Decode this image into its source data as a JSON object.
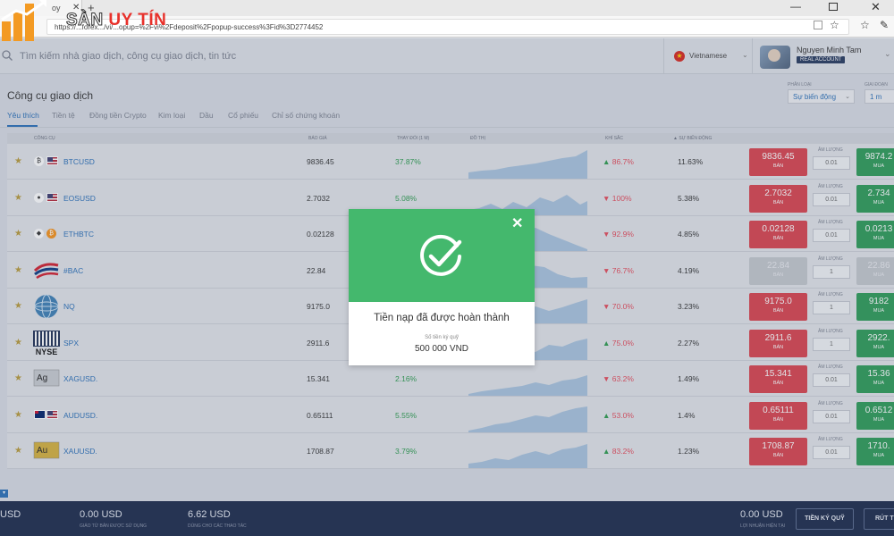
{
  "browser": {
    "tab_title": "oy",
    "url": "https://...forex.../vi/...opup=%2Fvi%2Fdeposit%2Fpopup-success%3Fid%3D2774452"
  },
  "watermark": {
    "part_a": "SÀN ",
    "part_b": "UY TÍN"
  },
  "header": {
    "search_placeholder": "Tìm kiếm nhà giao dịch, công cụ giao dịch, tin tức",
    "language": "Vietnamese",
    "user_name": "Nguyen Minh Tam",
    "account_badge": "REAL ACCOUNT"
  },
  "page": {
    "title": "Công cụ giao dịch",
    "tabs": [
      "Yêu thích",
      "Tiền tệ",
      "Đồng tiền Crypto",
      "Kim loại",
      "Dầu",
      "Cổ phiếu",
      "Chỉ số chứng khoán"
    ],
    "active_tab": "Yêu thích",
    "filter_category_label": "PHÂN LOẠI",
    "filter_category_value": "Sự biến động",
    "filter_period_label": "GIAI ĐOẠN",
    "filter_period_value": "1 m"
  },
  "table": {
    "columns": {
      "instrument": "CÔNG CỤ",
      "price": "BÁO GIÁ",
      "change": "THAY ĐỔI (1 M)",
      "chart": "ĐỒ THỊ",
      "sentiment": "KHÍ SẮC",
      "volatility": "▲ SỰ BIẾN ĐỘNG"
    },
    "qty_label": "ÂM LƯỢNG",
    "sell_label": "BÁN",
    "buy_label": "MUA",
    "rows": [
      {
        "symbol": "BTCUSD",
        "price": "9836.45",
        "change": "37.87%",
        "sentiment_dir": "up",
        "sentiment": "86.7%",
        "volatility": "11.63%",
        "sell": "9836.45",
        "qty": "0.01",
        "buy": "9874.2",
        "icon": "btc",
        "disabled": false
      },
      {
        "symbol": "EOSUSD",
        "price": "2.7032",
        "change": "5.08%",
        "sentiment_dir": "down",
        "sentiment": "100%",
        "volatility": "5.38%",
        "sell": "2.7032",
        "qty": "0.01",
        "buy": "2.734",
        "icon": "eos",
        "disabled": false
      },
      {
        "symbol": "ETHBTC",
        "price": "0.02128",
        "change": "",
        "sentiment_dir": "down",
        "sentiment": "92.9%",
        "volatility": "4.85%",
        "sell": "0.02128",
        "qty": "0.01",
        "buy": "0.0213",
        "icon": "eth",
        "disabled": false
      },
      {
        "symbol": "#BAC",
        "price": "22.84",
        "change": "",
        "sentiment_dir": "down",
        "sentiment": "76.7%",
        "volatility": "4.19%",
        "sell": "22.84",
        "qty": "1",
        "buy": "22.86",
        "icon": "bac",
        "disabled": true
      },
      {
        "symbol": "NQ",
        "price": "9175.0",
        "change": "",
        "sentiment_dir": "down",
        "sentiment": "70.0%",
        "volatility": "3.23%",
        "sell": "9175.0",
        "qty": "1",
        "buy": "9182",
        "icon": "nq",
        "disabled": false
      },
      {
        "symbol": "SPX",
        "price": "2911.6",
        "change": "",
        "sentiment_dir": "up",
        "sentiment": "75.0%",
        "volatility": "2.27%",
        "sell": "2911.6",
        "qty": "1",
        "buy": "2922.",
        "icon": "nyse",
        "disabled": false
      },
      {
        "symbol": "XAGUSD.",
        "price": "15.341",
        "change": "2.16%",
        "sentiment_dir": "down",
        "sentiment": "63.2%",
        "volatility": "1.49%",
        "sell": "15.341",
        "qty": "0.01",
        "buy": "15.36",
        "icon": "ag",
        "disabled": false
      },
      {
        "symbol": "AUDUSD.",
        "price": "0.65111",
        "change": "5.55%",
        "sentiment_dir": "up",
        "sentiment": "53.0%",
        "volatility": "1.4%",
        "sell": "0.65111",
        "qty": "0.01",
        "buy": "0.6512",
        "icon": "aud",
        "disabled": false
      },
      {
        "symbol": "XAUUSD.",
        "price": "1708.87",
        "change": "3.79%",
        "sentiment_dir": "up",
        "sentiment": "83.2%",
        "volatility": "1.23%",
        "sell": "1708.87",
        "qty": "0.01",
        "buy": "1710.",
        "icon": "au",
        "disabled": false
      }
    ]
  },
  "icon_labels": {
    "ag": "Ag",
    "au": "Au",
    "nyse": "NYSE"
  },
  "footer": {
    "tag": "▾",
    "usd_partial": "USD",
    "margin_value": "0.00 USD",
    "margin_label": "GIÁO TỪ BẢN ĐƯỢC SỬ DỤNG",
    "available_value": "6.62 USD",
    "available_label": "DÙNG CHO CÁC THAO TÁC",
    "profit_value": "0.00 USD",
    "profit_label": "LỢI NHUẬN HIỆN TẠI",
    "deposit_button": "TIỀN KÝ QUỸ",
    "withdraw_button": "RÚT TIỀ"
  },
  "modal": {
    "title": "Tiền nạp đã được hoàn thành",
    "amount_label": "Số tiền ký quỹ",
    "amount": "500 000 VND",
    "close": "✕"
  },
  "colors": {
    "sell": "#d9434d",
    "buy": "#2c9b57",
    "modal_green": "#44b86d",
    "footer_bg": "#1c2a4b",
    "link_blue": "#2a6fb8"
  }
}
